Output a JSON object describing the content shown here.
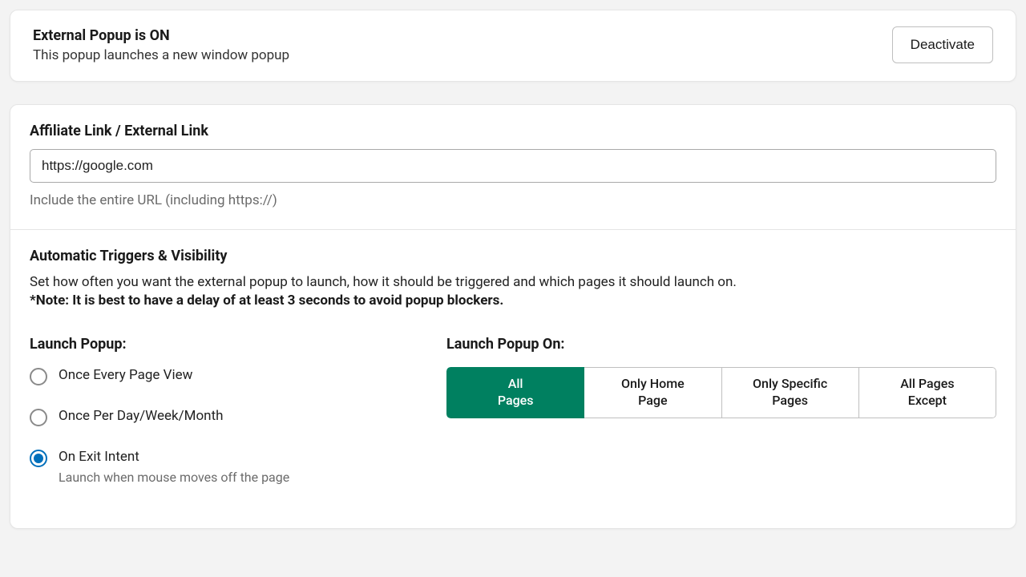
{
  "status": {
    "title": "External Popup is ON",
    "subtitle": "This popup launches a new window popup",
    "deactivate_label": "Deactivate"
  },
  "link": {
    "title": "Affiliate Link / External Link",
    "value": "https://google.com",
    "help": "Include the entire URL (including https://)"
  },
  "triggers": {
    "title": "Automatic Triggers & Visibility",
    "description": "Set how often you want the external popup to launch, how it should be triggered and which pages it should launch on.",
    "note": "*Note: It is best to have a delay of at least 3 seconds to avoid popup blockers.",
    "launch_popup_title": "Launch Popup:",
    "launch_on_title": "Launch Popup On:",
    "radios": [
      {
        "label": "Once Every Page View",
        "sub": "",
        "selected": false
      },
      {
        "label": "Once Per Day/Week/Month",
        "sub": "",
        "selected": false
      },
      {
        "label": "On Exit Intent",
        "sub": "Launch when mouse moves off the page",
        "selected": true
      }
    ],
    "segments": [
      {
        "label": "All\nPages",
        "active": true
      },
      {
        "label": "Only Home\nPage",
        "active": false
      },
      {
        "label": "Only Specific\nPages",
        "active": false
      },
      {
        "label": "All Pages\nExcept",
        "active": false
      }
    ]
  }
}
